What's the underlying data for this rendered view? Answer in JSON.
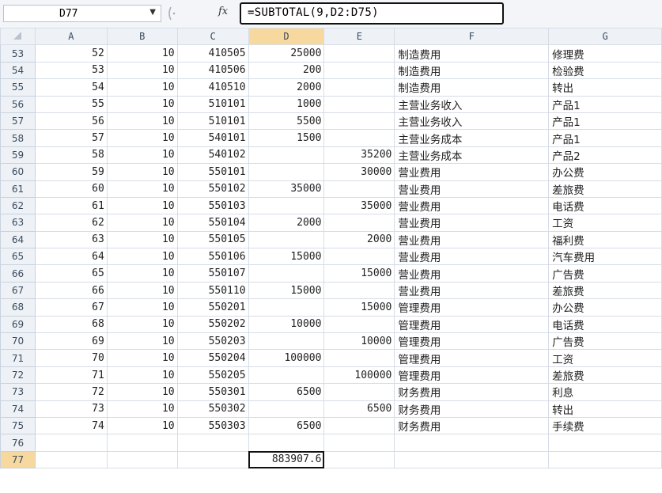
{
  "name_box": "D77",
  "name_box_dropdown": "▼",
  "formula_fx": "fx",
  "formula": "=SUBTOTAL(9,D2:D75)",
  "columns": [
    "A",
    "B",
    "C",
    "D",
    "E",
    "F",
    "G"
  ],
  "rows": [
    {
      "r": "53",
      "A": "52",
      "B": "10",
      "C": "410505",
      "D": "25000",
      "E": "",
      "F": "制造费用",
      "G": "修理费"
    },
    {
      "r": "54",
      "A": "53",
      "B": "10",
      "C": "410506",
      "D": "200",
      "E": "",
      "F": "制造费用",
      "G": "检验费"
    },
    {
      "r": "55",
      "A": "54",
      "B": "10",
      "C": "410510",
      "D": "2000",
      "E": "",
      "F": "制造费用",
      "G": "转出"
    },
    {
      "r": "56",
      "A": "55",
      "B": "10",
      "C": "510101",
      "D": "1000",
      "E": "",
      "F": "主营业务收入",
      "G": "产品1"
    },
    {
      "r": "57",
      "A": "56",
      "B": "10",
      "C": "510101",
      "D": "5500",
      "E": "",
      "F": "主营业务收入",
      "G": "产品1"
    },
    {
      "r": "58",
      "A": "57",
      "B": "10",
      "C": "540101",
      "D": "1500",
      "E": "",
      "F": "主营业务成本",
      "G": "产品1"
    },
    {
      "r": "59",
      "A": "58",
      "B": "10",
      "C": "540102",
      "D": "",
      "E": "35200",
      "F": "主营业务成本",
      "G": "产品2"
    },
    {
      "r": "60",
      "A": "59",
      "B": "10",
      "C": "550101",
      "D": "",
      "E": "30000",
      "F": "营业费用",
      "G": "办公费"
    },
    {
      "r": "61",
      "A": "60",
      "B": "10",
      "C": "550102",
      "D": "35000",
      "E": "",
      "F": "营业费用",
      "G": "差旅费"
    },
    {
      "r": "62",
      "A": "61",
      "B": "10",
      "C": "550103",
      "D": "",
      "E": "35000",
      "F": "营业费用",
      "G": "电话费"
    },
    {
      "r": "63",
      "A": "62",
      "B": "10",
      "C": "550104",
      "D": "2000",
      "E": "",
      "F": "营业费用",
      "G": "工资"
    },
    {
      "r": "64",
      "A": "63",
      "B": "10",
      "C": "550105",
      "D": "",
      "E": "2000",
      "F": "营业费用",
      "G": "福利费"
    },
    {
      "r": "65",
      "A": "64",
      "B": "10",
      "C": "550106",
      "D": "15000",
      "E": "",
      "F": "营业费用",
      "G": "汽车费用"
    },
    {
      "r": "66",
      "A": "65",
      "B": "10",
      "C": "550107",
      "D": "",
      "E": "15000",
      "F": "营业费用",
      "G": "广告费"
    },
    {
      "r": "67",
      "A": "66",
      "B": "10",
      "C": "550110",
      "D": "15000",
      "E": "",
      "F": "营业费用",
      "G": "差旅费"
    },
    {
      "r": "68",
      "A": "67",
      "B": "10",
      "C": "550201",
      "D": "",
      "E": "15000",
      "F": "管理费用",
      "G": "办公费"
    },
    {
      "r": "69",
      "A": "68",
      "B": "10",
      "C": "550202",
      "D": "10000",
      "E": "",
      "F": "管理费用",
      "G": "电话费"
    },
    {
      "r": "70",
      "A": "69",
      "B": "10",
      "C": "550203",
      "D": "",
      "E": "10000",
      "F": "管理费用",
      "G": "广告费"
    },
    {
      "r": "71",
      "A": "70",
      "B": "10",
      "C": "550204",
      "D": "100000",
      "E": "",
      "F": "管理费用",
      "G": "工资"
    },
    {
      "r": "72",
      "A": "71",
      "B": "10",
      "C": "550205",
      "D": "",
      "E": "100000",
      "F": "管理费用",
      "G": "差旅费"
    },
    {
      "r": "73",
      "A": "72",
      "B": "10",
      "C": "550301",
      "D": "6500",
      "E": "",
      "F": "财务费用",
      "G": "利息"
    },
    {
      "r": "74",
      "A": "73",
      "B": "10",
      "C": "550302",
      "D": "",
      "E": "6500",
      "F": "财务费用",
      "G": "转出"
    },
    {
      "r": "75",
      "A": "74",
      "B": "10",
      "C": "550303",
      "D": "6500",
      "E": "",
      "F": "财务费用",
      "G": "手续费"
    },
    {
      "r": "76",
      "A": "",
      "B": "",
      "C": "",
      "D": "",
      "E": "",
      "F": "",
      "G": ""
    },
    {
      "r": "77",
      "A": "",
      "B": "",
      "C": "",
      "D": "883907.6",
      "E": "",
      "F": "",
      "G": ""
    }
  ]
}
